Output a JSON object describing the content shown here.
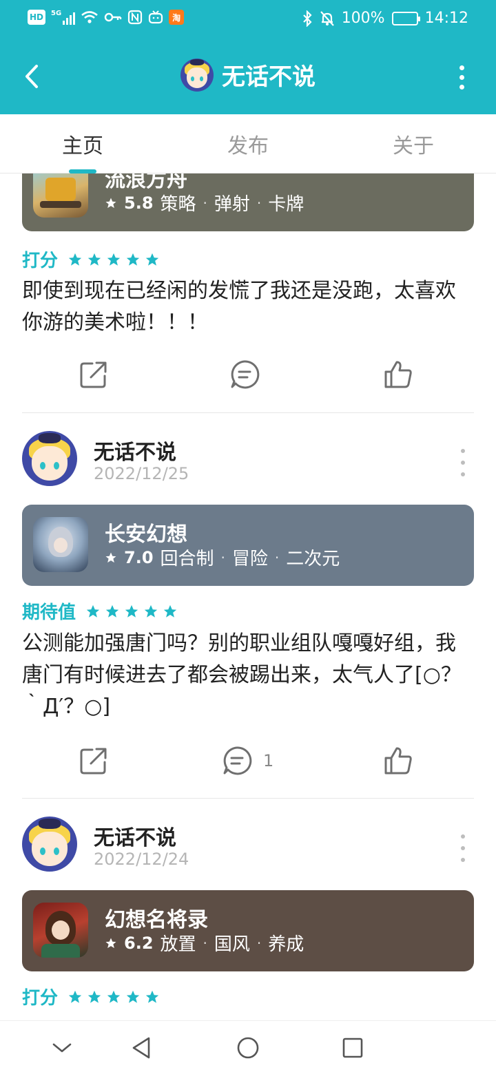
{
  "status_bar": {
    "hd_label": "HD",
    "network_label": "5G",
    "taobao_label": "淘",
    "battery_text": "100%",
    "time": "14:12"
  },
  "app_bar": {
    "title": "无话不说"
  },
  "tabs": [
    {
      "label": "主页",
      "active": true
    },
    {
      "label": "发布",
      "active": false
    },
    {
      "label": "关于",
      "active": false
    }
  ],
  "posts": [
    {
      "game": {
        "name": "流浪方舟",
        "score": "5.8",
        "tags": [
          "策略",
          "弹射",
          "卡牌"
        ],
        "card_color": "#6b6c5f"
      },
      "rating_label": "打分",
      "stars": 5,
      "text": "即使到现在已经闲的发慌了我还是没跑，太喜欢你游的美术啦！！！",
      "comment_count": ""
    },
    {
      "author": "无话不说",
      "date": "2022/12/25",
      "game": {
        "name": "长安幻想",
        "score": "7.0",
        "tags": [
          "回合制",
          "冒险",
          "二次元"
        ],
        "card_color": "#6c7b8b"
      },
      "rating_label": "期待值",
      "stars": 5,
      "text": "公测能加强唐门吗？别的职业组队嘎嘎好组，我唐门有时候进去了都会被踢出来，太气人了[○？｀Д′？○]",
      "comment_count": "1"
    },
    {
      "author": "无话不说",
      "date": "2022/12/24",
      "game": {
        "name": "幻想名将录",
        "score": "6.2",
        "tags": [
          "放置",
          "国风",
          "养成"
        ],
        "card_color": "#5d4e45"
      },
      "rating_label": "打分",
      "stars": 5
    }
  ],
  "icons": {
    "share": "share-icon",
    "comment": "comment-icon",
    "like": "thumbs-up-icon",
    "star": "star-icon"
  },
  "colors": {
    "accent": "#1fb8c6",
    "text": "#222222",
    "muted": "#b5b5b5"
  }
}
